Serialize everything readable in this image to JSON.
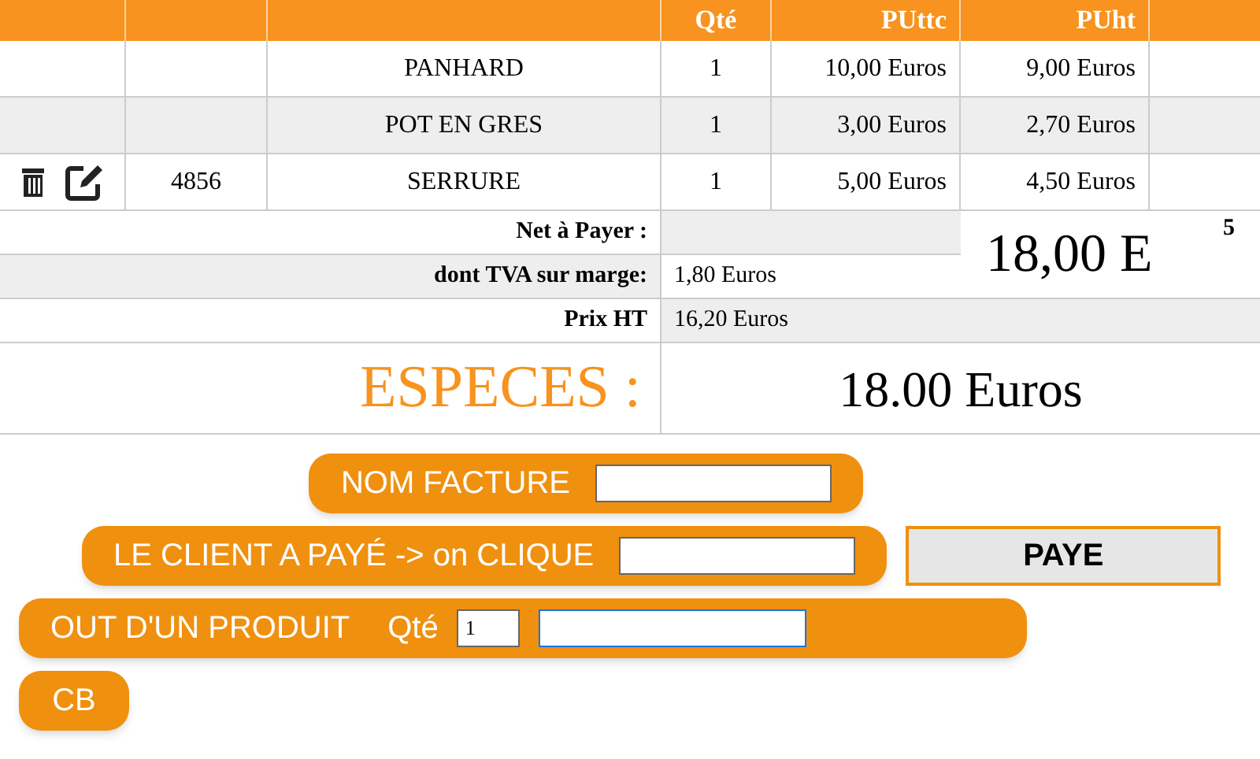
{
  "table": {
    "columns": [
      "Qté",
      "PUttc",
      "PUht"
    ],
    "rows": [
      {
        "actions": false,
        "designation": "PANHARD",
        "qty": "1",
        "pu_ttc": "10,00 Euros",
        "pu_ht": "9,00 Euros"
      },
      {
        "actions": false,
        "designation": "POT EN GRES",
        "qty": "1",
        "pu_ttc": "3,00 Euros",
        "pu_ht": "2,70 Euros"
      },
      {
        "actions": true,
        "code": "4856",
        "designation": "SERRURE",
        "qty": "1",
        "pu_ttc": "5,00 Euros",
        "pu_ht": "4,50 Euros"
      }
    ]
  },
  "summary": {
    "net_label": "Net à Payer :",
    "net_value": "18,00 E",
    "tva_label": "dont TVA sur marge:",
    "tva_value": "1,80 Euros",
    "extra": "5",
    "ht_label": "Prix HT",
    "ht_value": "16,20 Euros"
  },
  "payment": {
    "mode": "ESPECES :",
    "amount": "18.00 Euros"
  },
  "form": {
    "nom_facture": "NOM FACTURE",
    "client_paye": "LE CLIENT A PAYÉ -> on CLIQUE",
    "pay_button": "PAYE",
    "product": "OUT D'UN PRODUIT",
    "qty_label": "Qté",
    "qty_value": "1",
    "cb": "CB"
  }
}
